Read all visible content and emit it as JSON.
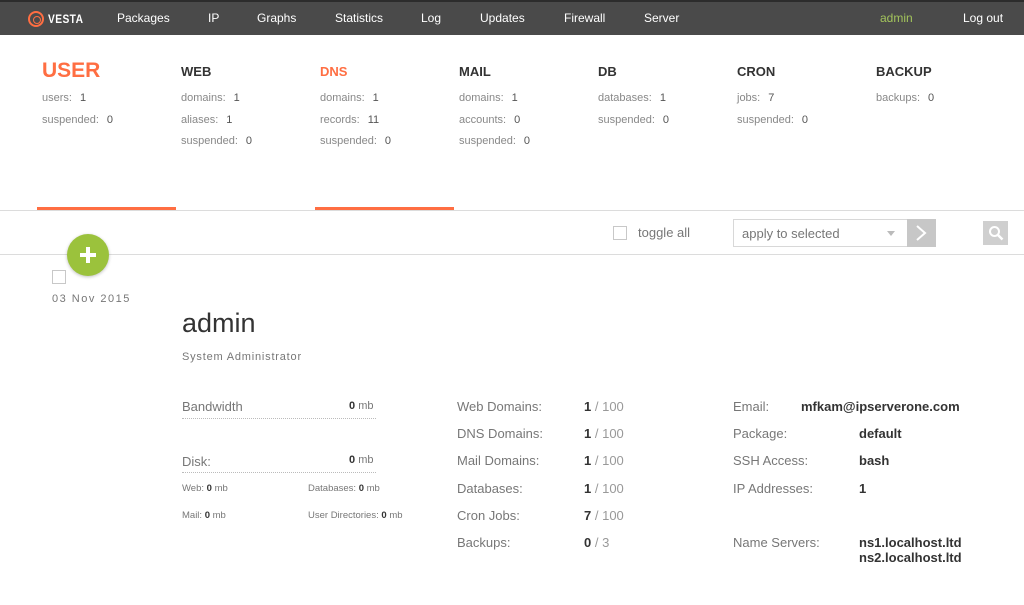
{
  "brand": {
    "name": "VESTA",
    "accent": "#ff6e42"
  },
  "nav": {
    "items": [
      "Packages",
      "IP",
      "Graphs",
      "Statistics",
      "Log",
      "Updates",
      "Firewall",
      "Server"
    ],
    "user": "admin",
    "logout": "Log out"
  },
  "stats": {
    "user": {
      "title": "USER",
      "rows": [
        {
          "label": "users:",
          "value": "1"
        },
        {
          "label": "suspended:",
          "value": "0"
        }
      ]
    },
    "web": {
      "title": "WEB",
      "rows": [
        {
          "label": "domains:",
          "value": "1"
        },
        {
          "label": "aliases:",
          "value": "1"
        },
        {
          "label": "suspended:",
          "value": "0"
        }
      ]
    },
    "dns": {
      "title": "DNS",
      "rows": [
        {
          "label": "domains:",
          "value": "1"
        },
        {
          "label": "records:",
          "value": "11"
        },
        {
          "label": "suspended:",
          "value": "0"
        }
      ]
    },
    "mail": {
      "title": "MAIL",
      "rows": [
        {
          "label": "domains:",
          "value": "1"
        },
        {
          "label": "accounts:",
          "value": "0"
        },
        {
          "label": "suspended:",
          "value": "0"
        }
      ]
    },
    "db": {
      "title": "DB",
      "rows": [
        {
          "label": "databases:",
          "value": "1"
        },
        {
          "label": "suspended:",
          "value": "0"
        }
      ]
    },
    "cron": {
      "title": "CRON",
      "rows": [
        {
          "label": "jobs:",
          "value": "7"
        },
        {
          "label": "suspended:",
          "value": "0"
        }
      ]
    },
    "backup": {
      "title": "BACKUP",
      "rows": [
        {
          "label": "backups:",
          "value": "0"
        }
      ]
    }
  },
  "toolbar": {
    "toggle_all": "toggle all",
    "apply_selected": "apply to selected"
  },
  "record": {
    "date": "03  Nov  2015",
    "name": "admin",
    "role": "System Administrator",
    "usage": {
      "bandwidth_label": "Bandwidth",
      "bandwidth_value": "0",
      "bandwidth_unit": "mb",
      "disk_label": "Disk:",
      "disk_value": "0",
      "disk_unit": "mb",
      "web_label": "Web:",
      "web_value": "0",
      "web_unit": "mb",
      "databases_label": "Databases:",
      "databases_value": "0",
      "databases_unit": "mb",
      "mail_label": "Mail:",
      "mail_value": "0",
      "mail_unit": "mb",
      "userdirs_label": "User Directories:",
      "userdirs_value": "0",
      "userdirs_unit": "mb"
    },
    "limits": [
      {
        "label": "Web Domains:",
        "used": "1",
        "total": "/ 100"
      },
      {
        "label": "DNS Domains:",
        "used": "1",
        "total": "/ 100"
      },
      {
        "label": "Mail Domains:",
        "used": "1",
        "total": "/ 100"
      },
      {
        "label": "Databases:",
        "used": "1",
        "total": "/ 100"
      },
      {
        "label": "Cron Jobs:",
        "used": "7",
        "total": "/ 100"
      },
      {
        "label": "Backups:",
        "used": "0",
        "total": "/ 3"
      }
    ],
    "info": {
      "email_label": "Email:",
      "email_value": "mfkam@ipserverone.com",
      "package_label": "Package:",
      "package_value": "default",
      "ssh_label": "SSH Access:",
      "ssh_value": "bash",
      "ip_label": "IP Addresses:",
      "ip_value": "1",
      "ns_label": "Name Servers:",
      "ns1": "ns1.localhost.ltd",
      "ns2": "ns2.localhost.ltd"
    }
  }
}
